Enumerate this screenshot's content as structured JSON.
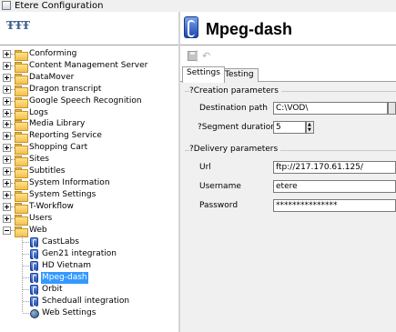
{
  "window": {
    "title": "Etere Configuration"
  },
  "tree": {
    "folders": [
      "Conforming",
      "Content Management Server",
      "DataMover",
      "Dragon transcript",
      "Google Speech Recognition",
      "Logs",
      "Media Library",
      "Reporting Service",
      "Shopping Cart",
      "Sites",
      "Subtitles",
      "System Information",
      "System Settings",
      "T-Workflow",
      "Users",
      "Web"
    ],
    "web_children": [
      {
        "label": "CastLabs",
        "icon": "cube-icon"
      },
      {
        "label": "Gen21 integration",
        "icon": "cube-icon"
      },
      {
        "label": "HD Vietnam",
        "icon": "cube-icon"
      },
      {
        "label": "Mpeg-dash",
        "icon": "cube-icon",
        "selected": true
      },
      {
        "label": "Orbit",
        "icon": "cube-icon"
      },
      {
        "label": "Scheduall integration",
        "icon": "cube-icon"
      },
      {
        "label": "Web Settings",
        "icon": "globe-icon"
      }
    ]
  },
  "page": {
    "title": "Mpeg-dash"
  },
  "toolbar": {
    "save_icon": "save-icon",
    "undo_icon": "undo-icon"
  },
  "tabs": [
    {
      "label": "Settings",
      "active": true
    },
    {
      "label": "Testing",
      "active": false
    }
  ],
  "creation": {
    "title": "?Creation parameters",
    "destination_label": "Destination path",
    "destination_value": "C:\\VOD\\",
    "segment_label": "?Segment duration",
    "segment_value": "5"
  },
  "delivery": {
    "title": "?Delivery parameters",
    "url_label": "Url",
    "url_value": "ftp://217.170.61.125/",
    "username_label": "Username",
    "username_value": "etere",
    "password_label": "Password",
    "password_value": "***************"
  },
  "colors": {
    "selection": "#3399ff",
    "folder": "#f3c04d",
    "cube": "#1f4fb5"
  }
}
